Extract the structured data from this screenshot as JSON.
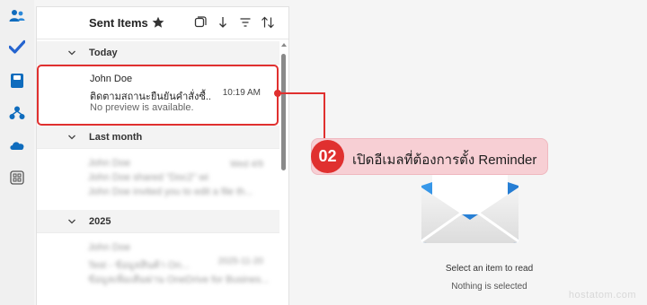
{
  "folder": {
    "title": "Sent Items"
  },
  "groups": {
    "today": "Today",
    "last_month": "Last month",
    "year": "2025"
  },
  "selected_mail": {
    "sender": "John Doe",
    "subject": "ติดตามสถานะยืนยันคำสั่งซื้...",
    "time": "10:19 AM",
    "preview": "No preview is available."
  },
  "blurred_mail_1": {
    "sender": "John Doe",
    "subject": "John Doe shared \"Doc2\" wi...",
    "time": "Wed 4/9",
    "preview": "John Doe invited you to edit a file th..."
  },
  "blurred_mail_2": {
    "sender": "John Doe",
    "subject": "Test - ข้อมูลสินค้า On...",
    "time": "2025-11-20",
    "preview": "ข้อมูลเพิ่มเติมผ่าน OneDrive for Busines..."
  },
  "reading_pane": {
    "empty_title": "Select an item to read",
    "empty_subtitle": "Nothing is selected"
  },
  "annotation": {
    "step": "02",
    "text": "เปิดอีเมลที่ต้องการตั้ง Reminder"
  },
  "watermark": "hostatom.com",
  "colors": {
    "accent": "#0f6cbd",
    "highlight": "#e0302f",
    "callout_bg": "#f7cfd4"
  },
  "icons": {
    "rail": [
      "people-icon",
      "todo-check-icon",
      "files-icon",
      "org-icon",
      "onedrive-cloud-icon",
      "apps-icon"
    ],
    "header": [
      "star-icon",
      "select-mode-icon",
      "jump-down-icon",
      "filter-icon",
      "sort-icon"
    ]
  }
}
